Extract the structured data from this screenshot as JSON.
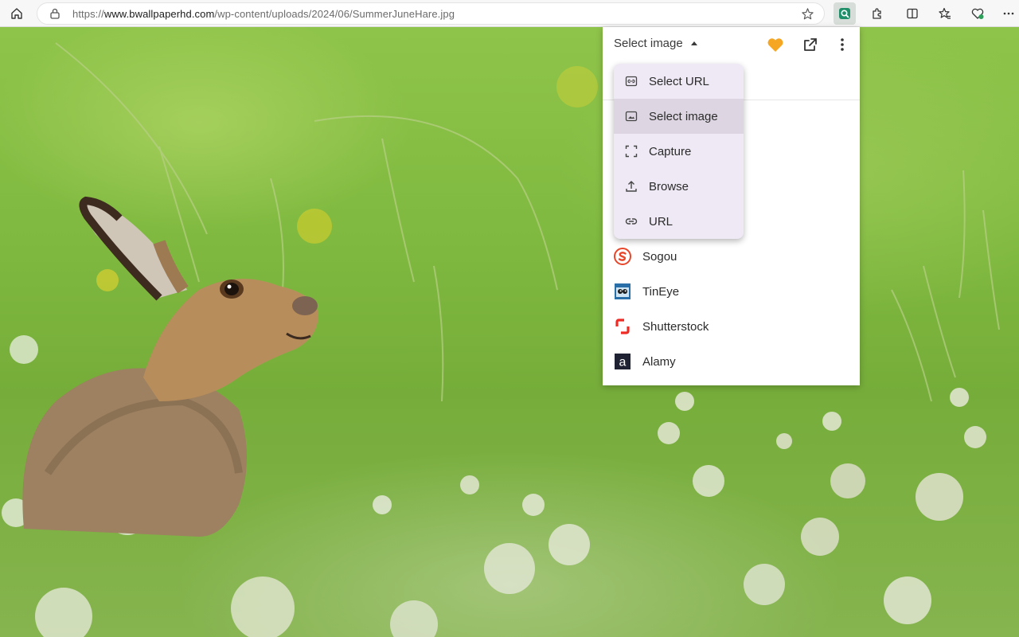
{
  "browser": {
    "url_prefix": "https://",
    "url_domain": "www.bwallpaperhd.com",
    "url_path": "/wp-content/uploads/2024/06/SummerJuneHare.jpg"
  },
  "popup": {
    "select_label": "Select image",
    "menu": [
      {
        "label": "Select URL",
        "icon": "link-box-icon"
      },
      {
        "label": "Select image",
        "icon": "image-box-icon"
      },
      {
        "label": "Capture",
        "icon": "capture-icon"
      },
      {
        "label": "Browse",
        "icon": "upload-icon"
      },
      {
        "label": "URL",
        "icon": "link-icon"
      }
    ],
    "engines": [
      {
        "name": "Sogou"
      },
      {
        "name": "TinEye"
      },
      {
        "name": "Shutterstock"
      },
      {
        "name": "Alamy"
      }
    ]
  },
  "colors": {
    "heart": "#f5a623",
    "menu_bg": "#efe9f5",
    "menu_selected": "#ddd6e2"
  }
}
